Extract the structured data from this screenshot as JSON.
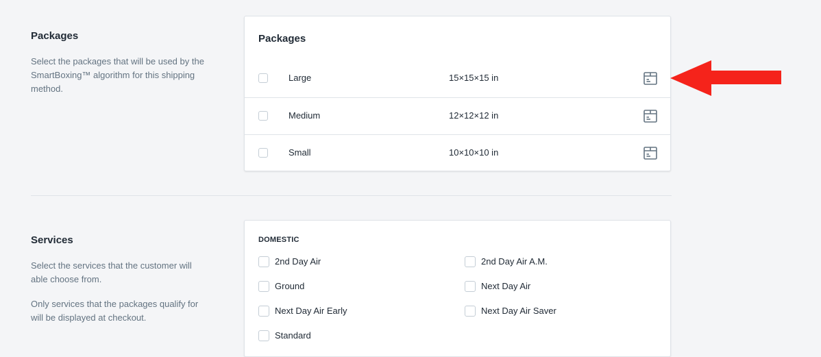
{
  "packages_section": {
    "title": "Packages",
    "description": "Select the packages that will be used by the SmartBoxing™ algorithm for this shipping method.",
    "card_title": "Packages",
    "items": [
      {
        "name": "Large",
        "dims": "15×15×15 in",
        "icon": "package-box-icon"
      },
      {
        "name": "Medium",
        "dims": "12×12×12 in",
        "icon": "package-box-icon"
      },
      {
        "name": "Small",
        "dims": "10×10×10 in",
        "icon": "package-box-icon"
      }
    ]
  },
  "services_section": {
    "title": "Services",
    "description_1": "Select the services that the customer will able choose from.",
    "description_2": "Only services that the packages qualify for will be displayed at checkout.",
    "group_label": "DOMESTIC",
    "services": [
      {
        "label": "2nd Day Air",
        "checked": false
      },
      {
        "label": "2nd Day Air A.M.",
        "checked": false
      },
      {
        "label": "Ground",
        "checked": false
      },
      {
        "label": "Next Day Air",
        "checked": false
      },
      {
        "label": "Next Day Air Early",
        "checked": false
      },
      {
        "label": "Next Day Air Saver",
        "checked": false
      },
      {
        "label": "Standard",
        "checked": false
      }
    ]
  },
  "colors": {
    "annotation_arrow": "#f5231b",
    "icon": "#637381",
    "border": "#dfe3e8"
  }
}
